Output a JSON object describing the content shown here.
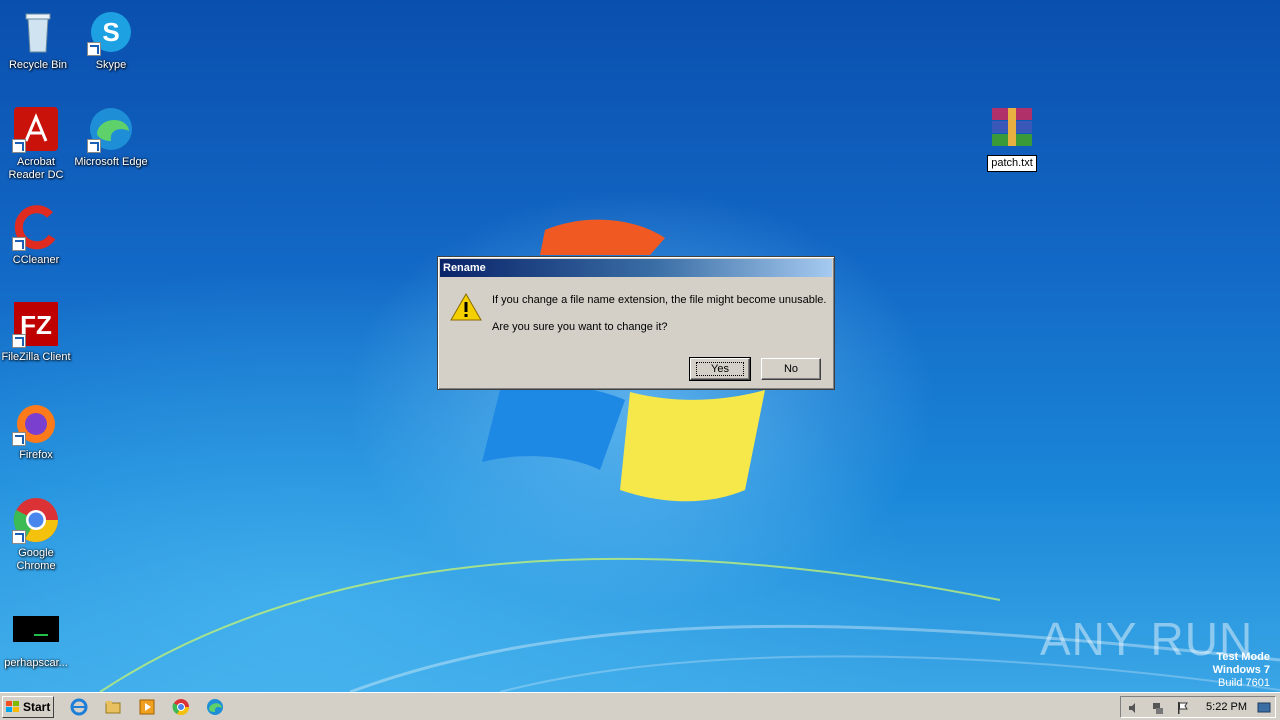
{
  "desktop": {
    "icons": [
      {
        "id": "recycle-bin",
        "label": "Recycle Bin"
      },
      {
        "id": "skype",
        "label": "Skype"
      },
      {
        "id": "acrobat",
        "label": "Acrobat Reader DC"
      },
      {
        "id": "edge",
        "label": "Microsoft Edge"
      },
      {
        "id": "ccleaner",
        "label": "CCleaner"
      },
      {
        "id": "filezilla",
        "label": "FileZilla Client"
      },
      {
        "id": "firefox",
        "label": "Firefox"
      },
      {
        "id": "chrome",
        "label": "Google Chrome"
      },
      {
        "id": "perhaps",
        "label": "perhapscar..."
      },
      {
        "id": "patch",
        "label": "patch.txt"
      }
    ]
  },
  "dialog": {
    "title": "Rename",
    "message1": "If you change a file name extension, the file might become unusable.",
    "message2": "Are you sure you want to change it?",
    "yes_label": "Yes",
    "no_label": "No",
    "icon": "warning-icon"
  },
  "taskbar": {
    "start_label": "Start",
    "clock": "5:22 PM",
    "pinned": [
      "internet-explorer-icon",
      "explorer-icon",
      "media-player-icon",
      "chrome-icon",
      "edge-icon"
    ]
  },
  "watermark": {
    "line1": "Test Mode",
    "line2": "Windows 7",
    "line3": "Build 7601",
    "brand": "ANY RUN"
  }
}
